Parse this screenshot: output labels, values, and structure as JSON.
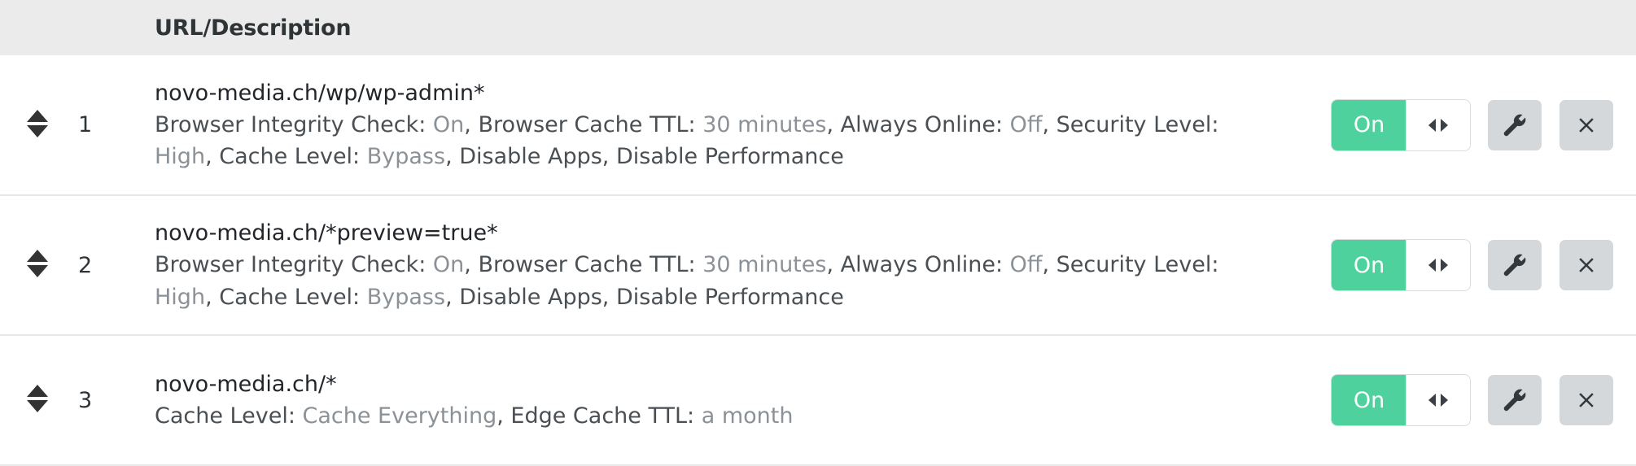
{
  "header": {
    "url_description": "URL/Description"
  },
  "toggle": {
    "on_label": "On"
  },
  "icons": {
    "drag_handle": "sort-updown-icon",
    "toggle_arrows": "left-right-arrows-icon",
    "settings": "wrench-icon",
    "delete": "close-x-icon"
  },
  "colors": {
    "header_bg": "#ebebeb",
    "toggle_on": "#4ed19d",
    "button_bg": "#d5d8da",
    "row_border": "#e8e8e8",
    "label_text": "#4a4f54",
    "value_text": "#8b9196"
  },
  "rules": [
    {
      "index": "1",
      "url": "novo-media.ch/wp/wp-admin*",
      "description": "Browser Integrity Check: On, Browser Cache TTL: 30 minutes, Always Online: Off, Security Level: High, Cache Level: Bypass, Disable Apps, Disable Performance",
      "settings": [
        {
          "label": "Browser Integrity Check: ",
          "value": "On",
          "sep": ", "
        },
        {
          "label": "Browser Cache TTL: ",
          "value": "30 minutes",
          "sep": ", "
        },
        {
          "label": "Always Online: ",
          "value": "Off",
          "sep": ", "
        },
        {
          "label": "Security Level: ",
          "value": "High",
          "sep": ", "
        },
        {
          "label": "Cache Level: ",
          "value": "Bypass",
          "sep": ", "
        },
        {
          "label": "Disable Apps",
          "value": "",
          "sep": ", "
        },
        {
          "label": "Disable Performance",
          "value": "",
          "sep": ""
        }
      ],
      "toggle_state": "On"
    },
    {
      "index": "2",
      "url": "novo-media.ch/*preview=true*",
      "description": "Browser Integrity Check: On, Browser Cache TTL: 30 minutes, Always Online: Off, Security Level: High, Cache Level: Bypass, Disable Apps, Disable Performance",
      "settings": [
        {
          "label": "Browser Integrity Check: ",
          "value": "On",
          "sep": ", "
        },
        {
          "label": "Browser Cache TTL: ",
          "value": "30 minutes",
          "sep": ", "
        },
        {
          "label": "Always Online: ",
          "value": "Off",
          "sep": ", "
        },
        {
          "label": "Security Level: ",
          "value": "High",
          "sep": ", "
        },
        {
          "label": "Cache Level: ",
          "value": "Bypass",
          "sep": ", "
        },
        {
          "label": "Disable Apps",
          "value": "",
          "sep": ", "
        },
        {
          "label": "Disable Performance",
          "value": "",
          "sep": ""
        }
      ],
      "toggle_state": "On"
    },
    {
      "index": "3",
      "url": "novo-media.ch/*",
      "description": "Cache Level: Cache Everything, Edge Cache TTL: a month",
      "settings": [
        {
          "label": "Cache Level: ",
          "value": "Cache Everything",
          "sep": ", "
        },
        {
          "label": "Edge Cache TTL: ",
          "value": "a month",
          "sep": ""
        }
      ],
      "toggle_state": "On"
    }
  ]
}
